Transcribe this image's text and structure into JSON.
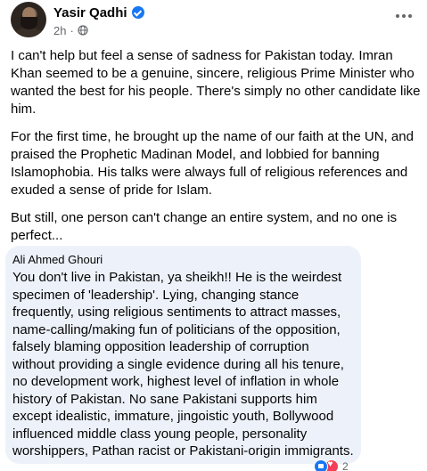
{
  "post": {
    "author": "Yasir Qadhi",
    "time": "2h",
    "separator": "·",
    "paragraphs": [
      "I can't help but feel a sense of sadness for Pakistan today. Imran Khan seemed to be a genuine, sincere, religious Prime Minister who wanted the best for his people. There's simply no other candidate like him.",
      "For the first time, he brought up the name of our faith at the UN, and praised the Prophetic Madinan Model, and lobbied for banning Islamophobia. His talks were always full of religious references and exuded a sense of pride for Islam.",
      "But still, one person can't change an entire system, and no one is perfect..."
    ]
  },
  "comment": {
    "author": "Ali Ahmed Ghouri",
    "text": "You don't live in Pakistan, ya sheikh!! He is the weirdest specimen of 'leadership'. Lying, changing stance frequently, using religious sentiments to attract masses, name-calling/making fun of politicians of the opposition, falsely blaming opposition leadership of corruption without providing a single evidence during all his tenure, no development work, highest level of inflation in whole history of Pakistan. No sane Pakistani supports him except idealistic, immature, jingoistic youth, Bollywood influenced middle class young people, personality worshippers, Pathan racist or Pakistani-origin immigrants.",
    "reaction_count": "2",
    "reactions": [
      "like-icon",
      "love-icon"
    ]
  },
  "colors": {
    "accent": "#1877f2",
    "comment_bg": "#edf2fa",
    "secondary_text": "#65676b",
    "love": "#f33e58"
  }
}
